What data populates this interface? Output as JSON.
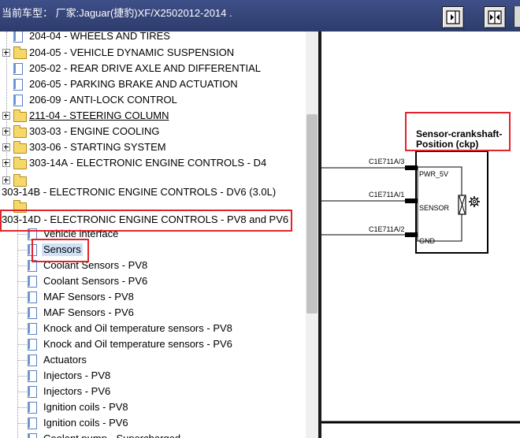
{
  "header": {
    "vehicle_label": "当前车型：  厂家:Jaguar(捷豹)XF/X2502012-2014   ."
  },
  "toolbar": {
    "buttons": [
      {
        "icon": "panel-right-icon"
      },
      {
        "icon": "split-arrows-icon"
      }
    ]
  },
  "tree": {
    "items": [
      {
        "label": "204-04 - WHEELS AND TIRES",
        "type": "doc"
      },
      {
        "label": "204-05 - VEHICLE DYNAMIC SUSPENSION",
        "type": "folder"
      },
      {
        "label": "205-02 - REAR DRIVE AXLE AND DIFFERENTIAL",
        "type": "doc"
      },
      {
        "label": "206-05 - PARKING BRAKE AND ACTUATION",
        "type": "doc"
      },
      {
        "label": "206-09 - ANTI-LOCK CONTROL",
        "type": "doc"
      },
      {
        "label": "211-04 - STEERING COLUMN",
        "type": "folder"
      },
      {
        "label": "303-03 - ENGINE COOLING",
        "type": "folder"
      },
      {
        "label": "303-06 - STARTING SYSTEM",
        "type": "folder"
      },
      {
        "label": "303-14A - ELECTRONIC ENGINE CONTROLS - D4",
        "type": "folder"
      },
      {
        "label": "303-14B - ELECTRONIC ENGINE CONTROLS - DV6 (3.0L)",
        "type": "folder"
      },
      {
        "label": "303-14D - ELECTRONIC ENGINE CONTROLS - PV8 and PV6",
        "type": "folder-open"
      }
    ],
    "children": [
      "Vehicle interface",
      "Sensors",
      "Coolant Sensors - PV8",
      "Coolant Sensors - PV6",
      "MAF Sensors - PV8",
      "MAF Sensors - PV6",
      "Knock and Oil temperature sensors - PV8",
      "Knock and Oil temperature sensors - PV6",
      "Actuators",
      "Injectors - PV8",
      "Injectors - PV6",
      "Ignition coils - PV8",
      "Ignition coils - PV6",
      "Coolant pump - Supercharged"
    ],
    "selected": "Sensors"
  },
  "diagram": {
    "component_title_line1": "Sensor-crankshaft-",
    "component_title_line2": "Position (ckp)",
    "connectors": [
      {
        "ref": "C1E711A/3",
        "pin": "PWR_5V"
      },
      {
        "ref": "C1E711A/1",
        "pin": "SENSOR"
      },
      {
        "ref": "C1E711A/2",
        "pin": "GND"
      }
    ]
  },
  "colors": {
    "header_bg": "#344477",
    "highlight_red": "#e3232b",
    "selection_bg": "#cfe0f5",
    "folder_yellow": "#f6d86a"
  }
}
